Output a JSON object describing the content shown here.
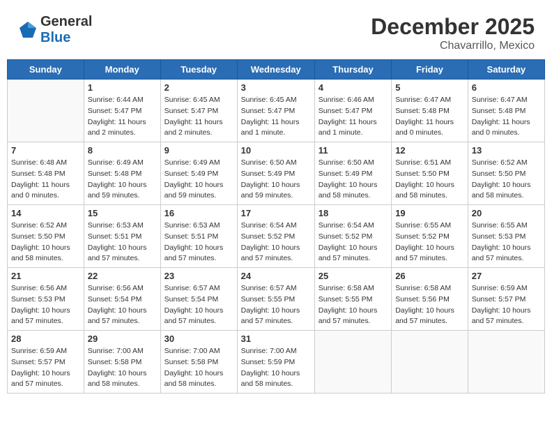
{
  "header": {
    "logo_general": "General",
    "logo_blue": "Blue",
    "month_year": "December 2025",
    "location": "Chavarrillo, Mexico"
  },
  "days_of_week": [
    "Sunday",
    "Monday",
    "Tuesday",
    "Wednesday",
    "Thursday",
    "Friday",
    "Saturday"
  ],
  "weeks": [
    [
      {
        "day": "",
        "info": ""
      },
      {
        "day": "1",
        "info": "Sunrise: 6:44 AM\nSunset: 5:47 PM\nDaylight: 11 hours\nand 2 minutes."
      },
      {
        "day": "2",
        "info": "Sunrise: 6:45 AM\nSunset: 5:47 PM\nDaylight: 11 hours\nand 2 minutes."
      },
      {
        "day": "3",
        "info": "Sunrise: 6:45 AM\nSunset: 5:47 PM\nDaylight: 11 hours\nand 1 minute."
      },
      {
        "day": "4",
        "info": "Sunrise: 6:46 AM\nSunset: 5:47 PM\nDaylight: 11 hours\nand 1 minute."
      },
      {
        "day": "5",
        "info": "Sunrise: 6:47 AM\nSunset: 5:48 PM\nDaylight: 11 hours\nand 0 minutes."
      },
      {
        "day": "6",
        "info": "Sunrise: 6:47 AM\nSunset: 5:48 PM\nDaylight: 11 hours\nand 0 minutes."
      }
    ],
    [
      {
        "day": "7",
        "info": "Sunrise: 6:48 AM\nSunset: 5:48 PM\nDaylight: 11 hours\nand 0 minutes."
      },
      {
        "day": "8",
        "info": "Sunrise: 6:49 AM\nSunset: 5:48 PM\nDaylight: 10 hours\nand 59 minutes."
      },
      {
        "day": "9",
        "info": "Sunrise: 6:49 AM\nSunset: 5:49 PM\nDaylight: 10 hours\nand 59 minutes."
      },
      {
        "day": "10",
        "info": "Sunrise: 6:50 AM\nSunset: 5:49 PM\nDaylight: 10 hours\nand 59 minutes."
      },
      {
        "day": "11",
        "info": "Sunrise: 6:50 AM\nSunset: 5:49 PM\nDaylight: 10 hours\nand 58 minutes."
      },
      {
        "day": "12",
        "info": "Sunrise: 6:51 AM\nSunset: 5:50 PM\nDaylight: 10 hours\nand 58 minutes."
      },
      {
        "day": "13",
        "info": "Sunrise: 6:52 AM\nSunset: 5:50 PM\nDaylight: 10 hours\nand 58 minutes."
      }
    ],
    [
      {
        "day": "14",
        "info": "Sunrise: 6:52 AM\nSunset: 5:50 PM\nDaylight: 10 hours\nand 58 minutes."
      },
      {
        "day": "15",
        "info": "Sunrise: 6:53 AM\nSunset: 5:51 PM\nDaylight: 10 hours\nand 57 minutes."
      },
      {
        "day": "16",
        "info": "Sunrise: 6:53 AM\nSunset: 5:51 PM\nDaylight: 10 hours\nand 57 minutes."
      },
      {
        "day": "17",
        "info": "Sunrise: 6:54 AM\nSunset: 5:52 PM\nDaylight: 10 hours\nand 57 minutes."
      },
      {
        "day": "18",
        "info": "Sunrise: 6:54 AM\nSunset: 5:52 PM\nDaylight: 10 hours\nand 57 minutes."
      },
      {
        "day": "19",
        "info": "Sunrise: 6:55 AM\nSunset: 5:52 PM\nDaylight: 10 hours\nand 57 minutes."
      },
      {
        "day": "20",
        "info": "Sunrise: 6:55 AM\nSunset: 5:53 PM\nDaylight: 10 hours\nand 57 minutes."
      }
    ],
    [
      {
        "day": "21",
        "info": "Sunrise: 6:56 AM\nSunset: 5:53 PM\nDaylight: 10 hours\nand 57 minutes."
      },
      {
        "day": "22",
        "info": "Sunrise: 6:56 AM\nSunset: 5:54 PM\nDaylight: 10 hours\nand 57 minutes."
      },
      {
        "day": "23",
        "info": "Sunrise: 6:57 AM\nSunset: 5:54 PM\nDaylight: 10 hours\nand 57 minutes."
      },
      {
        "day": "24",
        "info": "Sunrise: 6:57 AM\nSunset: 5:55 PM\nDaylight: 10 hours\nand 57 minutes."
      },
      {
        "day": "25",
        "info": "Sunrise: 6:58 AM\nSunset: 5:55 PM\nDaylight: 10 hours\nand 57 minutes."
      },
      {
        "day": "26",
        "info": "Sunrise: 6:58 AM\nSunset: 5:56 PM\nDaylight: 10 hours\nand 57 minutes."
      },
      {
        "day": "27",
        "info": "Sunrise: 6:59 AM\nSunset: 5:57 PM\nDaylight: 10 hours\nand 57 minutes."
      }
    ],
    [
      {
        "day": "28",
        "info": "Sunrise: 6:59 AM\nSunset: 5:57 PM\nDaylight: 10 hours\nand 57 minutes."
      },
      {
        "day": "29",
        "info": "Sunrise: 7:00 AM\nSunset: 5:58 PM\nDaylight: 10 hours\nand 58 minutes."
      },
      {
        "day": "30",
        "info": "Sunrise: 7:00 AM\nSunset: 5:58 PM\nDaylight: 10 hours\nand 58 minutes."
      },
      {
        "day": "31",
        "info": "Sunrise: 7:00 AM\nSunset: 5:59 PM\nDaylight: 10 hours\nand 58 minutes."
      },
      {
        "day": "",
        "info": ""
      },
      {
        "day": "",
        "info": ""
      },
      {
        "day": "",
        "info": ""
      }
    ]
  ]
}
